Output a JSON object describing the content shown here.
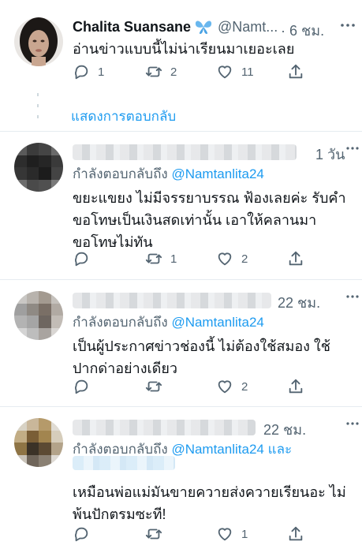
{
  "main_tweet": {
    "name": "Chalita Suansane",
    "handle": "@Namt...",
    "time": "· 6 ชม.",
    "text": "อ่านข่าวแบบนี้ไม่น่าเรียนมาเยอะเลย",
    "reply_count": "1",
    "retweet_count": "2",
    "like_count": "11",
    "show_replies": "แสดงการตอบกลับ"
  },
  "replies": [
    {
      "time": "1 วัน",
      "replying_prefix": "กำลังตอบกลับถึง",
      "mention": "@Namtanlita24",
      "mention_suffix": "",
      "text": "ขยะแขยง ไม่มีจรรยาบรรณ ฟ้องเลยค่ะ รับคำ ขอโทษเป็นเงินสดเท่านั้น เอาให้คลานมา ขอโทษไม่ทัน",
      "reply_count": "",
      "retweet_count": "1",
      "like_count": "2"
    },
    {
      "time": "22 ชม.",
      "replying_prefix": "กำลังตอบกลับถึง",
      "mention": "@Namtanlita24",
      "mention_suffix": "",
      "text": "เป็นผู้ประกาศข่าวช่องนี้ ไม่ต้องใช้สมอง ใช้ ปากด่าอย่างเดียว",
      "reply_count": "",
      "retweet_count": "",
      "like_count": "2"
    },
    {
      "time": "22 ชม.",
      "replying_prefix": "กำลังตอบกลับถึง",
      "mention": "@Namtanlita24",
      "mention_suffix": "และ",
      "text": "เหมือนพ่อแม่มันขายควายส่งควายเรียนอะ ไม่ พ้นปักตรมซะที!",
      "reply_count": "",
      "retweet_count": "",
      "like_count": "1"
    }
  ],
  "icons": {
    "reply": "reply-icon",
    "retweet": "retweet-icon",
    "like": "heart-icon",
    "share": "share-icon",
    "more": "more-icon",
    "badge": "butterfly-icon"
  },
  "colors": {
    "accent": "#1d9bf0",
    "secondary_text": "#536471",
    "divider": "#e6ecf0"
  }
}
